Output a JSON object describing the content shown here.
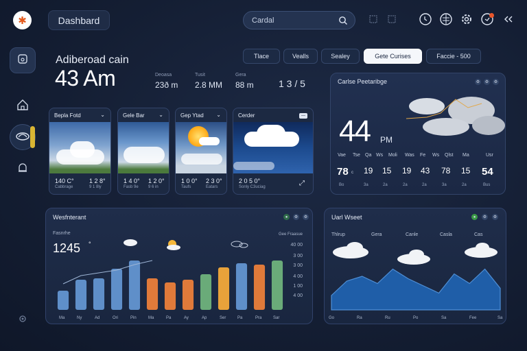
{
  "sidebar": {
    "logo_glyph": "✱",
    "items": [
      {
        "name": "app",
        "icon": "app-icon"
      },
      {
        "name": "home",
        "icon": "home-icon"
      },
      {
        "name": "weather",
        "icon": "weather-icon"
      },
      {
        "name": "alerts",
        "icon": "bell-icon"
      },
      {
        "name": "settings",
        "icon": "gear-icon"
      }
    ]
  },
  "header": {
    "dashboard_label": "Dashbard",
    "search_placeholder": "Cardal",
    "icons": [
      "grid-icon",
      "grid-icon",
      "clock-icon",
      "globe-icon",
      "gear-icon",
      "notification-icon",
      "collapse-icon"
    ]
  },
  "summary": {
    "greeting": "Adiberoad cain",
    "time": "43 Am",
    "stats": [
      {
        "label": "Deoasa",
        "value": "23ð m"
      },
      {
        "label": "Tusit",
        "value": "2.8 MM"
      },
      {
        "label": "Gera",
        "value": "88 m"
      }
    ],
    "fraction": "1 3 / 5"
  },
  "filters": [
    "Tlace",
    "Vealls",
    "Sealey",
    "Gete Curises",
    "Faccie - 500"
  ],
  "filters_selected_index": 3,
  "cards": [
    {
      "title": "Bepla Fotd",
      "temp1": "140 C°",
      "temp2": "1 2 8°",
      "sub1": "Cabbrage",
      "sub2": "9 1 8ly"
    },
    {
      "title": "Gele Bar",
      "temp1": "1 4 0°",
      "temp2": "1 2 0°",
      "sub1": "Fasb 9e",
      "sub2": "9 6 in"
    },
    {
      "title": "Gep Ytad",
      "temp1": "1 0 0°",
      "temp2": "2 3 0°",
      "sub1": "Taufs",
      "sub2": "Eatars"
    },
    {
      "title": "Cerder",
      "temp1": "2 0 5 0°",
      "temp2": "",
      "sub1": "Sonly C3uciag",
      "sub2": ""
    }
  ],
  "forecast": {
    "title": "Carlse  Peetaribge",
    "temperature": "44",
    "unit": "PM",
    "hours": [
      "Vae",
      "Tse",
      "Qa",
      "Ws",
      "Moli",
      "Was",
      "Fe",
      "Ws",
      "Qlst",
      "Ma",
      "Usr"
    ],
    "values": [
      "78",
      "19",
      "15",
      "19",
      "43",
      "78",
      "15",
      "54"
    ],
    "value_units": [
      "c",
      "",
      "",
      "",
      "",
      "",
      "",
      ""
    ],
    "subs": [
      "Bo",
      "3a",
      "2a",
      "2a",
      "2a",
      "3a",
      "2a",
      "Bus"
    ]
  },
  "chart_panel": {
    "title": "Wesfnterant",
    "label": "Fasnrhe",
    "value": "1245",
    "value_unit": "°",
    "legend": "Gee Fraasue"
  },
  "chart_data": {
    "type": "bar",
    "categories": [
      "Ma",
      "Ny",
      "Ad",
      "Ori",
      "Pin",
      "Ma",
      "Pa",
      "Ay",
      "Ap",
      "Ser",
      "Pa",
      "Pra",
      "Sar"
    ],
    "values": [
      14,
      22,
      23,
      30,
      36,
      23,
      20,
      22,
      26,
      31,
      34,
      33,
      36
    ],
    "colors": [
      "#5f8fc9",
      "#5f8fc9",
      "#5f8fc9",
      "#5f8fc9",
      "#5f8fc9",
      "#e07a3a",
      "#e07a3a",
      "#e07a3a",
      "#6aab79",
      "#e8a23a",
      "#5f8fc9",
      "#e07a3a",
      "#6aab79"
    ],
    "y_ticks": [
      "40 00",
      "3 00",
      "3 00",
      "4 00",
      "1 00",
      "4 00"
    ],
    "line": [
      19,
      25,
      27,
      29,
      33,
      36
    ]
  },
  "wind_panel": {
    "title": "Uarl Wseet",
    "labels": [
      "Thlrup",
      "Gera",
      "Canle",
      "Casla",
      "Cas"
    ],
    "series_values": [
      12,
      24,
      28,
      22,
      34,
      26,
      20,
      14,
      30,
      22,
      34,
      18
    ],
    "x_labels": [
      "Go",
      "Ra",
      "Ru",
      "Po",
      "Sa",
      "Fee",
      "Sa"
    ]
  }
}
